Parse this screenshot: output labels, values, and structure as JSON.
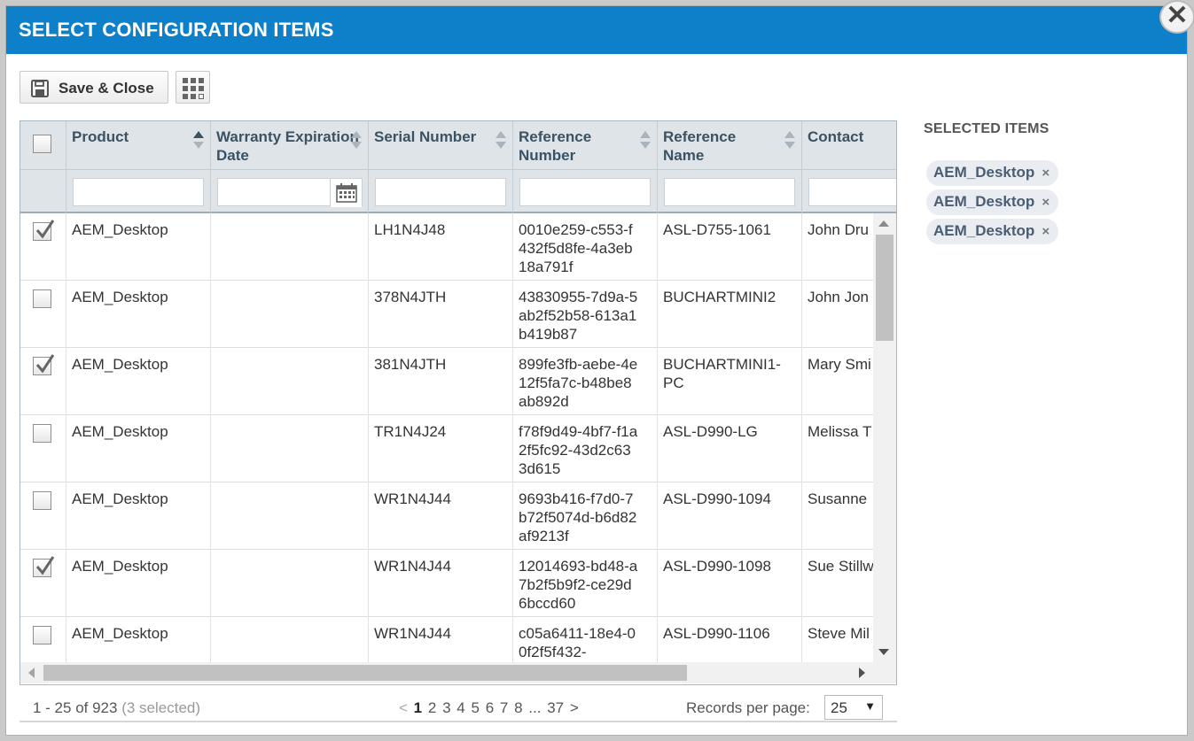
{
  "dialog": {
    "title": "SELECT CONFIGURATION ITEMS",
    "close_glyph": "✕"
  },
  "toolbar": {
    "save_label": "Save & Close",
    "save_icon": "floppy-disk-icon",
    "columns_icon": "grid-icon"
  },
  "table": {
    "columns": [
      "Product",
      "Warranty Expiration Date",
      "Serial Number",
      "Reference Number",
      "Reference Name",
      "Contact"
    ],
    "sort_active": "Product",
    "rows": [
      {
        "checked": true,
        "product": "AEM_Desktop",
        "warranty": "",
        "serial": "LH1N4J48",
        "reference_number": "0010e259-c553-f432f5d8fe-4a3eb18a791f",
        "reference_name": "ASL-D755-1061",
        "contact": "John Dru"
      },
      {
        "checked": false,
        "product": "AEM_Desktop",
        "warranty": "",
        "serial": "378N4JTH",
        "reference_number": "43830955-7d9a-5ab2f52b58-613a1b419b87",
        "reference_name": "BUCHARTMINI2",
        "contact": "John Jon"
      },
      {
        "checked": true,
        "product": "AEM_Desktop",
        "warranty": "",
        "serial": "381N4JTH",
        "reference_number": "899fe3fb-aebe-4e12f5fa7c-b48be8ab892d",
        "reference_name": "BUCHARTMINI1-PC",
        "contact": "Mary Smi"
      },
      {
        "checked": false,
        "product": "AEM_Desktop",
        "warranty": "",
        "serial": "TR1N4J24",
        "reference_number": "f78f9d49-4bf7-f1a2f5fc92-43d2c633d615",
        "reference_name": "ASL-D990-LG",
        "contact": "Melissa T"
      },
      {
        "checked": false,
        "product": "AEM_Desktop",
        "warranty": "",
        "serial": "WR1N4J44",
        "reference_number": "9693b416-f7d0-7b72f5074d-b6d82af9213f",
        "reference_name": "ASL-D990-1094",
        "contact": "Susanne"
      },
      {
        "checked": true,
        "product": "AEM_Desktop",
        "warranty": "",
        "serial": "WR1N4J44",
        "reference_number": "12014693-bd48-a7b2f5b9f2-ce29d6bccd60",
        "reference_name": "ASL-D990-1098",
        "contact": "Sue Stillw"
      },
      {
        "checked": false,
        "product": "AEM_Desktop",
        "warranty": "",
        "serial": "WR1N4J44",
        "reference_number": "c05a6411-18e4-00f2f5f432-",
        "reference_name": "ASL-D990-1106",
        "contact": "Steve Mil"
      }
    ]
  },
  "pager": {
    "range": "1 - 25 of 923",
    "selected": "(3 selected)",
    "prev": "<",
    "pages": [
      "1",
      "2",
      "3",
      "4",
      "5",
      "6",
      "7",
      "8",
      "...",
      "37"
    ],
    "current_page": "1",
    "next": ">",
    "records_label": "Records per page:",
    "records_value": "25",
    "caret": "▼"
  },
  "selected_items": {
    "title": "SELECTED ITEMS",
    "items": [
      "AEM_Desktop",
      "AEM_Desktop",
      "AEM_Desktop"
    ],
    "remove_glyph": "×"
  },
  "colors": {
    "header": "#0d80c9",
    "grid_header": "#dfe4e8",
    "chip": "#e9ecf1"
  }
}
